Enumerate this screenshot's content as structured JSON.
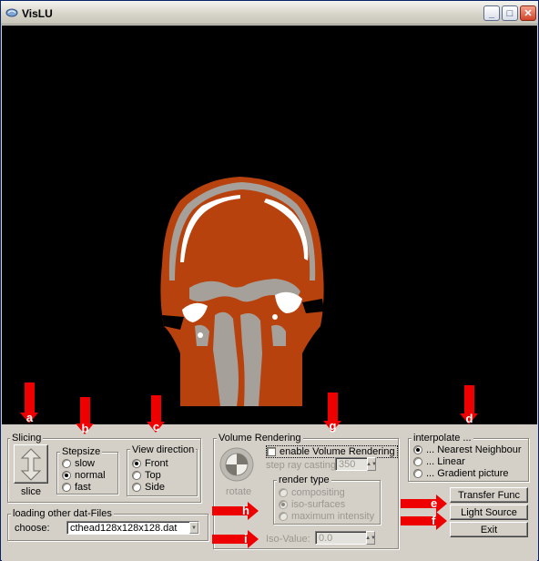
{
  "window": {
    "title": "VisLU",
    "min_label": "_",
    "max_label": "□",
    "close_label": "✕"
  },
  "slicing": {
    "legend": "Slicing",
    "slice_label": "slice"
  },
  "stepsize": {
    "legend": "Stepsize",
    "options": [
      "slow",
      "normal",
      "fast"
    ],
    "selected": "normal"
  },
  "view": {
    "legend": "View direction",
    "options": [
      "Front",
      "Top",
      "Side"
    ],
    "selected": "Front"
  },
  "files": {
    "legend": "loading other dat-Files",
    "choose_label": "choose:",
    "selected_file": "cthead128x128x128.dat"
  },
  "volume": {
    "legend": "Volume Rendering",
    "enable_label": "enable Volume Rendering",
    "rotate_label": "rotate",
    "step_label": "step ray casting",
    "step_value": "350",
    "render_type_legend": "render type",
    "render_types": [
      "compositing",
      "iso-surfaces",
      "maximum intensity"
    ],
    "render_selected": "iso-surfaces",
    "iso_label": "Iso-Value:",
    "iso_value": "0.0"
  },
  "interpolate": {
    "legend": "interpolate ...",
    "options": [
      "... Nearest Neighbour",
      "... Linear",
      "... Gradient picture"
    ],
    "selected": "... Nearest Neighbour"
  },
  "buttons": {
    "transfer": "Transfer Func",
    "light": "Light Source",
    "exit": "Exit"
  },
  "annotations": [
    "a",
    "b",
    "c",
    "d",
    "e",
    "f",
    "g",
    "h",
    "i"
  ],
  "colors": {
    "tissue": "#b8420e",
    "bone": "#9c9890",
    "bright": "#ffffff",
    "background": "#000000",
    "annotation": "#ee0000"
  }
}
